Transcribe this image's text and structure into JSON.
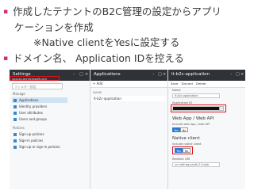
{
  "slide": {
    "lines": [
      {
        "bullet": true,
        "text": "作成したテナントのB2C管理の設定からアプリ"
      },
      {
        "bullet": false,
        "text": "ケーションを作成"
      },
      {
        "bullet": false,
        "text": "※Native clientをYesに設定する"
      },
      {
        "bullet": true,
        "text": "ドメイン名、 Application IDを控える"
      }
    ],
    "bullet_char": "▪",
    "accent_color": "#e0131d"
  },
  "settings": {
    "title": "Settings",
    "subtitle": "xxxxxx.onmicrosoft.com",
    "search_placeholder": "フィルター設定",
    "groups": [
      {
        "label": "Manage",
        "items": [
          {
            "label": "Applications",
            "selected": true
          },
          {
            "label": "Identity providers",
            "selected": false
          },
          {
            "label": "User attributes",
            "selected": false
          },
          {
            "label": "Users and groups",
            "selected": false
          }
        ]
      },
      {
        "label": "Policies",
        "items": [
          {
            "label": "Sign-up policies",
            "selected": false
          },
          {
            "label": "Sign-in policies",
            "selected": false
          },
          {
            "label": "Sign-up or sign-in policies",
            "selected": false
          }
        ]
      }
    ]
  },
  "applications": {
    "title": "Applications",
    "add_label": "Add",
    "column": "NAME",
    "rows": [
      "lt-b2c-application"
    ]
  },
  "app_blade": {
    "title": "lt-b2c-application",
    "commands": [
      "Save",
      "Discard",
      "Delete"
    ],
    "name_label": "Name",
    "name_value": "lt-b2c-application",
    "appid_label": "Application ID",
    "appid_value": "00000000-0000-0000-0000-000000000000",
    "webapp_title": "Web App / Web API",
    "include_label": "Include web app / web API",
    "native_title": "Native client",
    "include_native_label": "Include native client",
    "yes": "Yes",
    "no": "No",
    "redirect_label": "Redirect URI",
    "redirect_value": "urn:ietf:wg:oauth:2.0:oob"
  }
}
